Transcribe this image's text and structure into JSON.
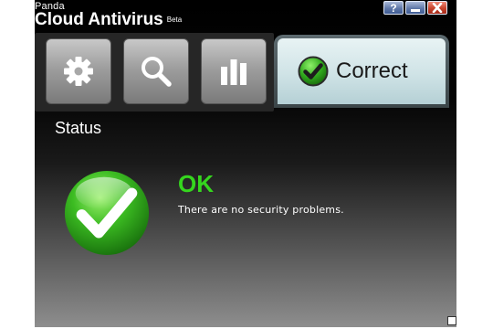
{
  "app": {
    "brand_small": "Panda",
    "brand_main": "Cloud Antivirus",
    "brand_beta": "Beta"
  },
  "window_buttons": {
    "help": "?"
  },
  "tabs": [
    {
      "id": "settings",
      "icon": "gear-icon"
    },
    {
      "id": "scan",
      "icon": "magnifier-icon"
    },
    {
      "id": "reports",
      "icon": "bar-chart-icon"
    }
  ],
  "status_tab": {
    "label": "Correct",
    "icon": "green-check-icon"
  },
  "main": {
    "heading": "Status",
    "status": "OK",
    "message": "There are no security problems."
  },
  "colors": {
    "ok_green": "#35d61e",
    "check_green": "#2da61a",
    "window_bg_top": "#000000",
    "window_bg_bottom": "#8e8e8e"
  }
}
